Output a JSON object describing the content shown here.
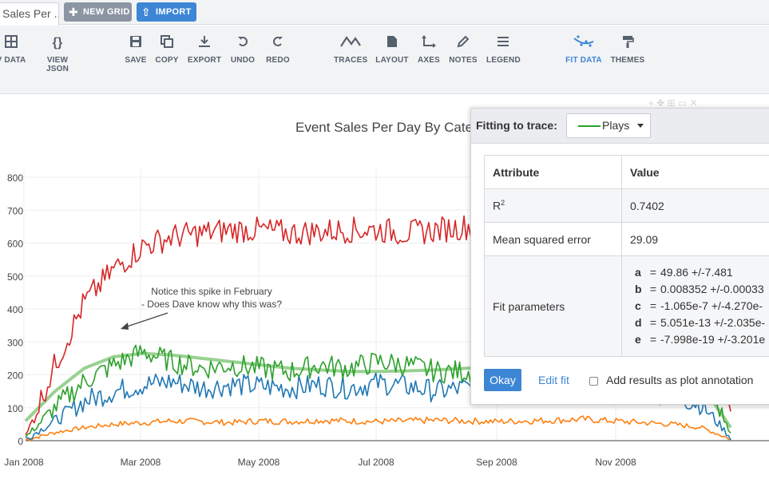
{
  "tabs": {
    "active_label": "Sales Per ...",
    "new_grid": "NEW GRID",
    "import": "IMPORT"
  },
  "toolbar": {
    "items": [
      {
        "label": "V DATA",
        "icon": "grid-icon"
      },
      {
        "label": "VIEW JSON",
        "icon": "braces-icon"
      },
      {
        "label": "SAVE",
        "icon": "save-icon"
      },
      {
        "label": "COPY",
        "icon": "copy-icon"
      },
      {
        "label": "EXPORT",
        "icon": "export-icon"
      },
      {
        "label": "UNDO",
        "icon": "undo-icon"
      },
      {
        "label": "REDO",
        "icon": "redo-icon"
      },
      {
        "label": "TRACES",
        "icon": "traces-icon"
      },
      {
        "label": "LAYOUT",
        "icon": "layout-icon"
      },
      {
        "label": "AXES",
        "icon": "axes-icon"
      },
      {
        "label": "NOTES",
        "icon": "pencil-icon"
      },
      {
        "label": "LEGEND",
        "icon": "legend-icon"
      },
      {
        "label": "FIT DATA",
        "icon": "fit-data-icon"
      },
      {
        "label": "THEMES",
        "icon": "paint-roller-icon"
      }
    ],
    "active_color": "#3d86d6"
  },
  "chart": {
    "title": "Event Sales Per Day By Cate",
    "annotation_line1": "Notice this spike in February",
    "annotation_line2": "- Does Dave know why this was?"
  },
  "chart_data": {
    "type": "line",
    "ylim": [
      0,
      800
    ],
    "y_ticks": [
      "0",
      "100",
      "200",
      "300",
      "400",
      "500",
      "600",
      "700",
      "800"
    ],
    "x_ticks": [
      "Jan 2008",
      "Mar 2008",
      "May 2008",
      "Jul 2008",
      "Sep 2008",
      "Nov 2008"
    ],
    "colors": {
      "red": "#d62728",
      "green": "#2ca02c",
      "blue": "#1f77b4",
      "orange": "#ff7f0e",
      "fit": "#98d190"
    },
    "series_shape": {
      "red": [
        10,
        230,
        420,
        520,
        590,
        620,
        630,
        640,
        640,
        630,
        635,
        640,
        640,
        630,
        640,
        650,
        650,
        620,
        600,
        610,
        620,
        580,
        500,
        300,
        100
      ],
      "green": [
        10,
        100,
        180,
        230,
        270,
        240,
        220,
        230,
        220,
        210,
        230,
        220,
        240,
        230,
        210,
        210,
        200,
        210,
        220,
        240,
        250,
        240,
        230,
        200,
        30
      ],
      "blue": [
        5,
        60,
        120,
        150,
        170,
        180,
        160,
        170,
        165,
        160,
        170,
        160,
        175,
        165,
        150,
        160,
        155,
        165,
        160,
        170,
        175,
        150,
        140,
        110,
        10
      ],
      "orange": [
        2,
        25,
        40,
        50,
        55,
        60,
        58,
        55,
        60,
        58,
        62,
        60,
        58,
        60,
        62,
        60,
        58,
        60,
        62,
        65,
        60,
        55,
        50,
        40,
        5
      ],
      "fit": [
        60,
        150,
        220,
        255,
        265,
        260,
        250,
        240,
        230,
        220,
        215,
        210,
        210,
        212,
        215,
        220,
        225,
        230,
        235,
        240,
        240,
        235,
        220,
        170,
        40
      ]
    }
  },
  "fit_panel": {
    "label": "Fitting to trace:",
    "trace": "Plays",
    "trace_color": "#2ca02c",
    "header_attribute": "Attribute",
    "header_value": "Value",
    "r2_label": "R",
    "r2_sup": "2",
    "r2_value": "0.7402",
    "mse_label": "Mean squared error",
    "mse_value": "29.09",
    "params_label": "Fit parameters",
    "params": [
      {
        "name": "a",
        "value": "49.86 +/-7.481"
      },
      {
        "name": "b",
        "value": "0.008352 +/-0.00033"
      },
      {
        "name": "c",
        "value": "-1.065e-7 +/-4.270e-"
      },
      {
        "name": "d",
        "value": "5.051e-13 +/-2.035e-"
      },
      {
        "name": "e",
        "value": "-7.998e-19 +/-3.201e"
      }
    ],
    "ok": "Okay",
    "edit": "Edit fit",
    "annotation_checkbox": "Add results as plot annotation"
  }
}
